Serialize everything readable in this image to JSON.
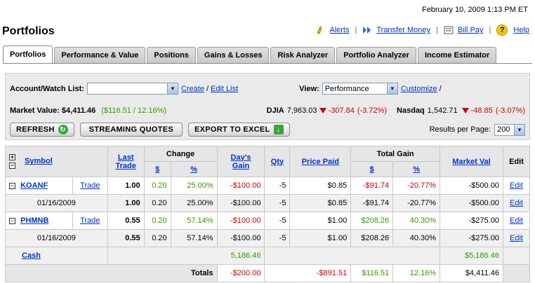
{
  "datetime": "February 10, 2009 1:13 PM ET",
  "title": "Portfolios",
  "toplinks": {
    "alerts": "Alerts",
    "transfer": "Transfer Money",
    "billpay": "Bill Pay",
    "help": "Help"
  },
  "tabs": [
    "Portfolios",
    "Performance & Value",
    "Positions",
    "Gains & Losses",
    "Risk Analyzer",
    "Portfolio Analyzer",
    "Income Estimator"
  ],
  "controls": {
    "account_label": "Account/Watch List:",
    "account_value": "",
    "create": "Create",
    "slash": "/",
    "edit_list": "Edit List",
    "view_label": "View:",
    "view_value": "Performance",
    "customize": "Customize",
    "customize_slash": "/"
  },
  "market": {
    "label": "Market Value:",
    "value": "$4,411.46",
    "gain": "($116.51 / 12.16%)",
    "djia_label": "DJIA",
    "djia_value": "7,963.03",
    "djia_change": "-307.84",
    "djia_pct": "(-3.72%)",
    "nasdaq_label": "Nasdaq",
    "nasdaq_value": "1,542.71",
    "nasdaq_change": "-48.85",
    "nasdaq_pct": "(-3.07%)"
  },
  "buttons": {
    "refresh": "REFRESH",
    "streaming": "STREAMING QUOTES",
    "export": "EXPORT TO EXCEL"
  },
  "results": {
    "label": "Results per Page:",
    "value": "200"
  },
  "table": {
    "headers": {
      "symbol": "Symbol",
      "last_trade_1": "Last",
      "last_trade_2": "Trade",
      "change": "Change",
      "change_dollar": "$",
      "change_pct": "%",
      "days_gain_1": "Day's",
      "days_gain_2": "Gain",
      "qty": "Qty",
      "price_paid": "Price Paid",
      "total_gain": "Total Gain",
      "tg_dollar": "$",
      "tg_pct": "%",
      "market_val": "Market Val",
      "edit": "Edit"
    },
    "rows": [
      {
        "symbol": "KOANF",
        "trade": "Trade",
        "last": "1.00",
        "chg": "0.20",
        "chgpct": "25.00%",
        "days": "-$100.00",
        "qty": "-5",
        "paid": "$0.85",
        "tg": "-$91.74",
        "tgpct": "-20.77%",
        "mv": "-$500.00",
        "edit": "Edit"
      },
      {
        "date": "01/16/2009",
        "last": "1.00",
        "chg": "0.20",
        "chgpct": "25.00%",
        "days": "-$100.00",
        "qty": "-5",
        "paid": "$0.85",
        "tg": "-$91.74",
        "tgpct": "-20.77%",
        "mv": "-$500.00",
        "edit": "Edit"
      },
      {
        "symbol": "PHMNB",
        "trade": "Trade",
        "last": "0.55",
        "chg": "0.20",
        "chgpct": "57.14%",
        "days": "-$100.00",
        "qty": "-5",
        "paid": "$1.00",
        "tg": "$208.26",
        "tgpct": "40.30%",
        "mv": "-$275.00",
        "edit": "Edit"
      },
      {
        "date": "01/16/2009",
        "last": "0.55",
        "chg": "0.20",
        "chgpct": "57.14%",
        "days": "-$100.00",
        "qty": "-5",
        "paid": "$1.00",
        "tg": "$208.26",
        "tgpct": "40.30%",
        "mv": "-$275.00",
        "edit": "Edit"
      }
    ],
    "cash": {
      "label": "Cash",
      "value": "5,186.46",
      "mv": "$5,186.46"
    },
    "totals": {
      "label": "Totals",
      "days": "-$200.00",
      "tg_paid": "-$891.51",
      "tg": "$116.51",
      "tgpct": "12.16%",
      "mv": "$4,411.46"
    }
  },
  "colors": {
    "link": "#0033cc",
    "gain": "#339900",
    "loss": "#cc0000"
  }
}
